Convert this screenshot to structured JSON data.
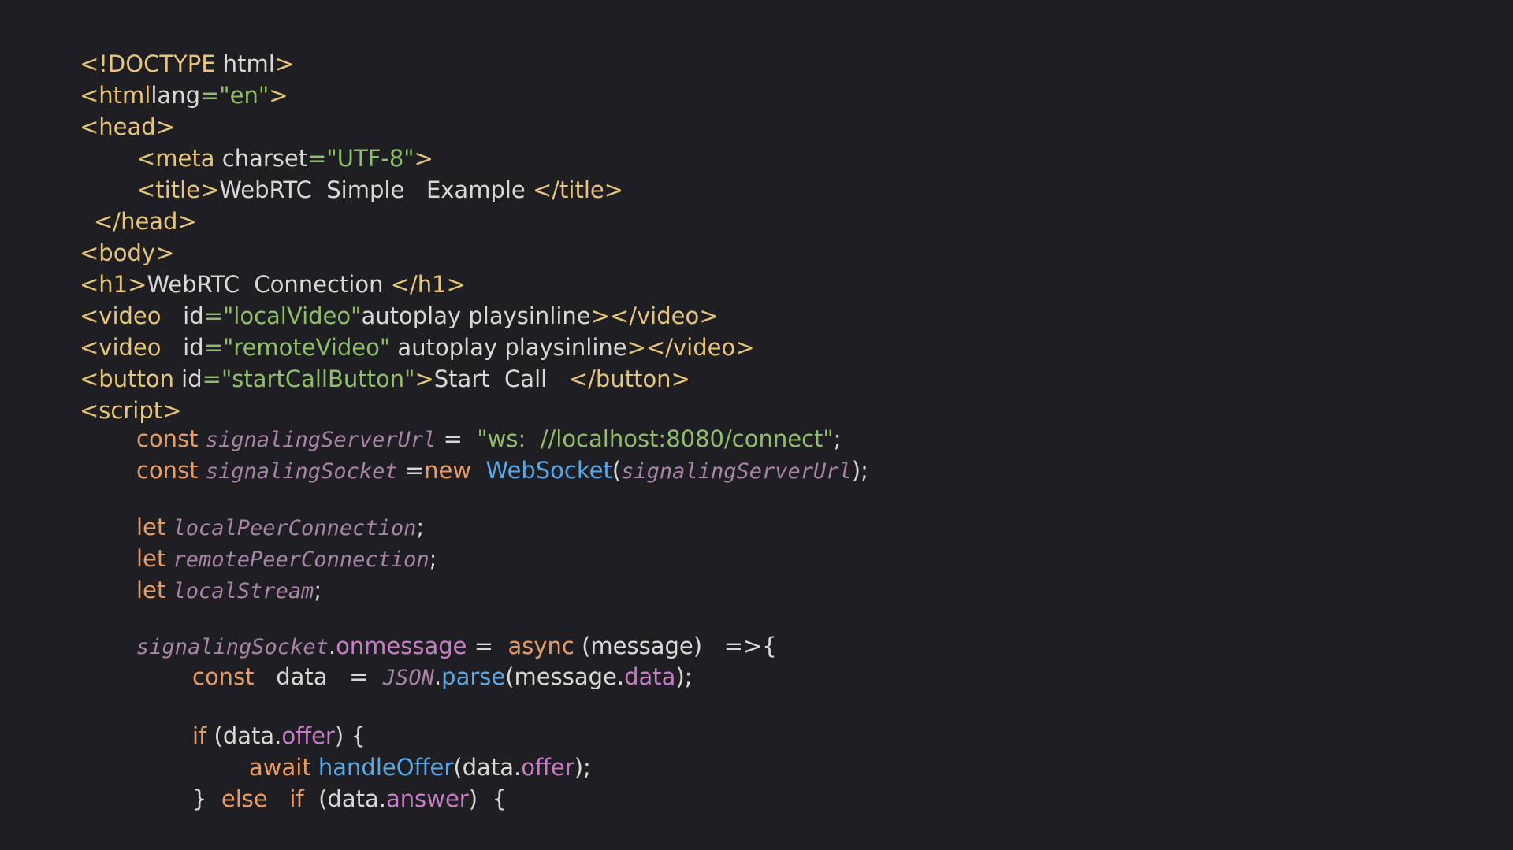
{
  "colors": {
    "background": "#1f1f23",
    "tag": "#e6c47a",
    "string": "#8fbf6a",
    "keyword": "#e89b64",
    "variable": "#a884a8",
    "function": "#5aa8e8",
    "property": "#c77dc6",
    "text": "#d8d8d8"
  },
  "lines": [
    [
      {
        "c": "tag",
        "t": "<!DOCTYPE"
      },
      {
        "c": "txt",
        "t": " html"
      },
      {
        "c": "tag",
        "t": ">"
      }
    ],
    [
      {
        "c": "tag",
        "t": "<html"
      },
      {
        "c": "attr",
        "t": "lang"
      },
      {
        "c": "eq",
        "t": "="
      },
      {
        "c": "str",
        "t": "\"en\""
      },
      {
        "c": "tag",
        "t": ">"
      }
    ],
    [
      {
        "c": "tag",
        "t": "<head>"
      }
    ],
    [
      {
        "c": "tag",
        "t": "<meta"
      },
      {
        "c": "attr",
        "t": " charset"
      },
      {
        "c": "eq",
        "t": "="
      },
      {
        "c": "str",
        "t": "\"UTF-8\""
      },
      {
        "c": "tag",
        "t": ">"
      }
    ],
    [
      {
        "c": "tag",
        "t": "<title>"
      },
      {
        "c": "txt",
        "t": "WebRTC  Simple   Example "
      },
      {
        "c": "tag",
        "t": "</title>"
      }
    ],
    [
      {
        "c": "tag",
        "t": "</head>"
      }
    ],
    [
      {
        "c": "tag",
        "t": "<body>"
      }
    ],
    [
      {
        "c": "tag",
        "t": "<h1>"
      },
      {
        "c": "txt",
        "t": "WebRTC  Connection "
      },
      {
        "c": "tag",
        "t": "</h1>"
      }
    ],
    [
      {
        "c": "tag",
        "t": "<video"
      },
      {
        "c": "attr",
        "t": "   id"
      },
      {
        "c": "eq",
        "t": "="
      },
      {
        "c": "str",
        "t": "\"localVideo\""
      },
      {
        "c": "attr",
        "t": "autoplay playsinline"
      },
      {
        "c": "tag",
        "t": "></video>"
      }
    ],
    [
      {
        "c": "tag",
        "t": "<video"
      },
      {
        "c": "attr",
        "t": "   id"
      },
      {
        "c": "eq",
        "t": "="
      },
      {
        "c": "str",
        "t": "\"remoteVideo\""
      },
      {
        "c": "attr",
        "t": " autoplay playsinline"
      },
      {
        "c": "tag",
        "t": "></video>"
      }
    ],
    [
      {
        "c": "tag",
        "t": "<button"
      },
      {
        "c": "attr",
        "t": " id"
      },
      {
        "c": "eq",
        "t": "="
      },
      {
        "c": "str",
        "t": "\"startCallButton\""
      },
      {
        "c": "tag",
        "t": ">"
      },
      {
        "c": "txt",
        "t": "Start  Call   "
      },
      {
        "c": "tag",
        "t": "</button>"
      }
    ],
    [
      {
        "c": "tag",
        "t": "<script>"
      }
    ],
    [
      {
        "c": "kw",
        "t": "const "
      },
      {
        "c": "var",
        "t": "signalingServerUrl"
      },
      {
        "c": "plain",
        "t": " =  "
      },
      {
        "c": "str",
        "t": "\"ws:  //localhost:8080/connect\""
      },
      {
        "c": "plain",
        "t": ";"
      }
    ],
    [
      {
        "c": "kw",
        "t": "const "
      },
      {
        "c": "var",
        "t": "signalingSocket"
      },
      {
        "c": "plain",
        "t": " ="
      },
      {
        "c": "kw",
        "t": "new  "
      },
      {
        "c": "fn",
        "t": "WebSocket"
      },
      {
        "c": "plain",
        "t": "("
      },
      {
        "c": "var",
        "t": "signalingServerUrl"
      },
      {
        "c": "plain",
        "t": ");"
      }
    ],
    [
      {
        "c": "kw",
        "t": "let "
      },
      {
        "c": "var",
        "t": "localPeerConnection"
      },
      {
        "c": "plain",
        "t": ";"
      }
    ],
    [
      {
        "c": "kw",
        "t": "let "
      },
      {
        "c": "var",
        "t": "remotePeerConnection"
      },
      {
        "c": "plain",
        "t": ";"
      }
    ],
    [
      {
        "c": "kw",
        "t": "let "
      },
      {
        "c": "var",
        "t": "localStream"
      },
      {
        "c": "plain",
        "t": ";"
      }
    ],
    [
      {
        "c": "var",
        "t": "signalingSocket"
      },
      {
        "c": "plain",
        "t": "."
      },
      {
        "c": "prop",
        "t": "onmessage"
      },
      {
        "c": "plain",
        "t": " =  "
      },
      {
        "c": "kw",
        "t": "async"
      },
      {
        "c": "plain",
        "t": " (message)   =>{"
      }
    ],
    [
      {
        "c": "kw",
        "t": "const"
      },
      {
        "c": "plain",
        "t": "   data   =  "
      },
      {
        "c": "var",
        "t": "JSON"
      },
      {
        "c": "plain",
        "t": "."
      },
      {
        "c": "fn",
        "t": "parse"
      },
      {
        "c": "plain",
        "t": "(message."
      },
      {
        "c": "prop",
        "t": "data"
      },
      {
        "c": "plain",
        "t": ");"
      }
    ],
    [
      {
        "c": "kw",
        "t": "if"
      },
      {
        "c": "plain",
        "t": " (data."
      },
      {
        "c": "prop",
        "t": "offer"
      },
      {
        "c": "plain",
        "t": ") {"
      }
    ],
    [
      {
        "c": "kw",
        "t": "await "
      },
      {
        "c": "fn",
        "t": "handleOffer"
      },
      {
        "c": "plain",
        "t": "(data."
      },
      {
        "c": "prop",
        "t": "offer"
      },
      {
        "c": "plain",
        "t": ");"
      }
    ],
    [
      {
        "c": "plain",
        "t": "}  "
      },
      {
        "c": "kw",
        "t": "else   if"
      },
      {
        "c": "plain",
        "t": "  (data."
      },
      {
        "c": "prop",
        "t": "answer"
      },
      {
        "c": "plain",
        "t": ")  {"
      }
    ]
  ]
}
